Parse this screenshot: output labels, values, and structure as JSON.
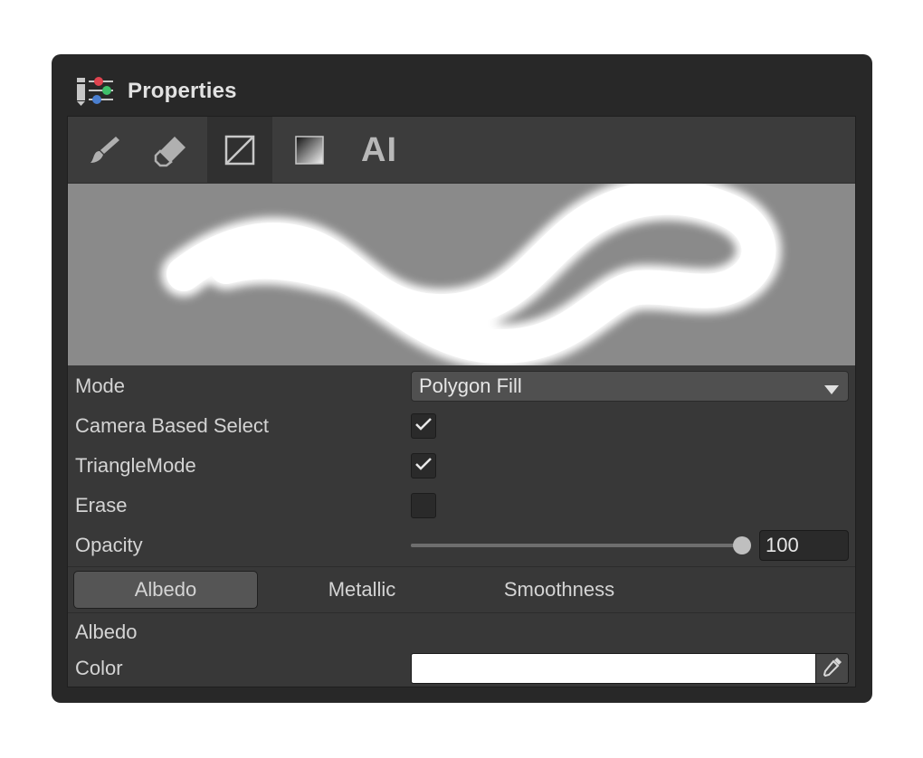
{
  "window": {
    "title": "Properties",
    "icon": "properties-sliders-icon"
  },
  "toolbar": {
    "tools": [
      {
        "name": "brush-icon",
        "active": false
      },
      {
        "name": "eraser-icon",
        "active": false
      },
      {
        "name": "polygon-fill-icon",
        "active": true
      },
      {
        "name": "gradient-icon",
        "active": false
      },
      {
        "name": "ai-icon",
        "label": "AI",
        "active": false
      }
    ]
  },
  "preview": {
    "background": "#8a8a8a",
    "stroke_color": "#ffffff"
  },
  "properties": {
    "mode_label": "Mode",
    "mode_value": "Polygon Fill",
    "camera_based_select_label": "Camera Based Select",
    "camera_based_select_checked": true,
    "triangle_mode_label": "TriangleMode",
    "triangle_mode_checked": true,
    "erase_label": "Erase",
    "erase_checked": false,
    "opacity_label": "Opacity",
    "opacity_value": "100",
    "opacity_fraction": 1.0
  },
  "channel_tabs": {
    "items": [
      {
        "label": "Albedo",
        "active": true
      },
      {
        "label": "Metallic",
        "active": false
      },
      {
        "label": "Smoothness",
        "active": false
      }
    ]
  },
  "albedo_section": {
    "heading": "Albedo",
    "color_label": "Color",
    "color_value": "#ffffff"
  }
}
